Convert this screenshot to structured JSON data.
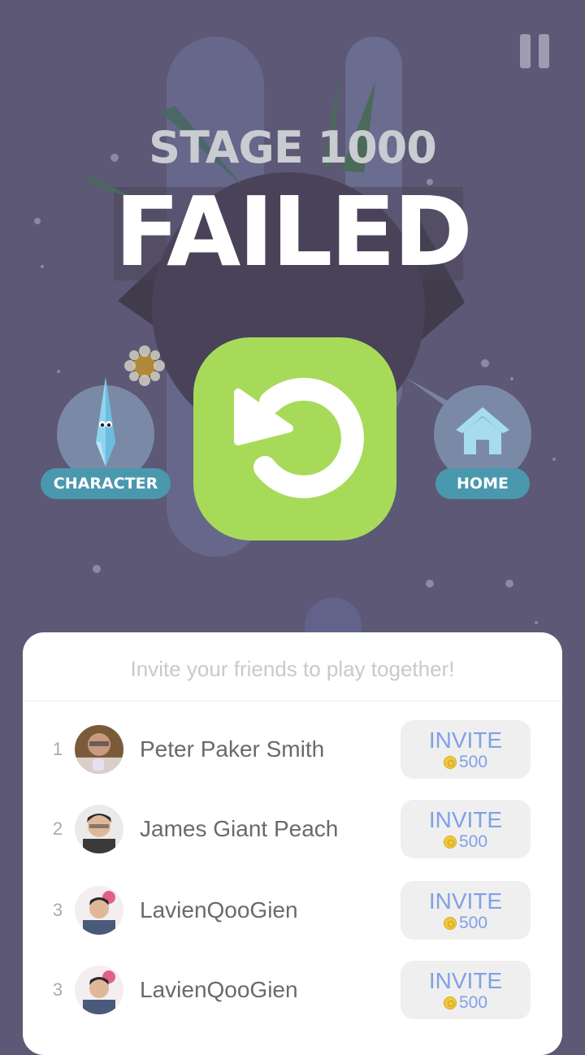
{
  "stage": "STAGE 1000",
  "result": "FAILED",
  "buttons": {
    "character": "CHARACTER",
    "home": "HOME"
  },
  "colors": {
    "background": "#5c5875",
    "retry": "#a8da5a",
    "label": "#4a98ad",
    "invite_text": "#80a0e8"
  },
  "icons": [
    "pause-icon",
    "retry-icon",
    "character-icon",
    "home-icon",
    "coin-icon"
  ],
  "invite_panel": {
    "title": "Invite your friends to play together!",
    "friends": [
      {
        "rank": "1",
        "name": "Peter Paker Smith",
        "invite_label": "INVITE",
        "reward": "500"
      },
      {
        "rank": "2",
        "name": "James Giant Peach",
        "invite_label": "INVITE",
        "reward": "500"
      },
      {
        "rank": "3",
        "name": "LavienQooGien",
        "invite_label": "INVITE",
        "reward": "500"
      },
      {
        "rank": "3",
        "name": "LavienQooGien",
        "invite_label": "INVITE",
        "reward": "500"
      }
    ]
  }
}
